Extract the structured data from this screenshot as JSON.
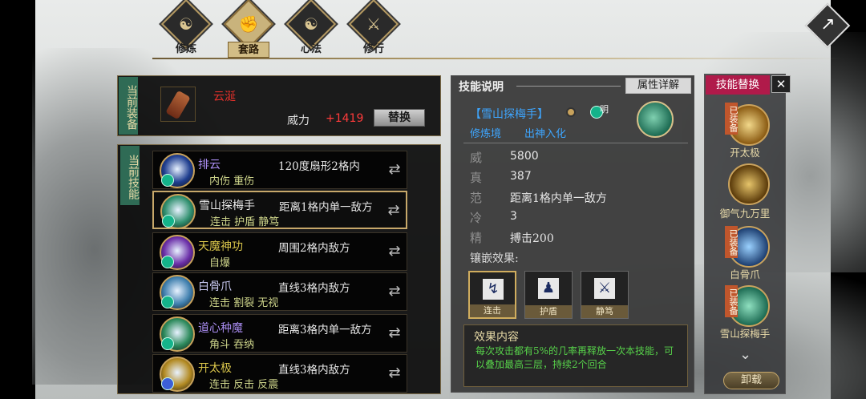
{
  "tabs": [
    {
      "label": "修炼",
      "icon": "cultivation-icon",
      "active": false
    },
    {
      "label": "套路",
      "icon": "fist-icon",
      "active": true
    },
    {
      "label": "心法",
      "icon": "taiji-icon",
      "active": false
    },
    {
      "label": "修行",
      "icon": "sword-icon",
      "active": false
    }
  ],
  "equip": {
    "section_label": "当前装备",
    "name": "云涎",
    "power_label": "威力",
    "power_value": "+1419",
    "replace_label": "替换"
  },
  "skills_label": "当前技能",
  "skills": [
    {
      "name": "排云",
      "name_color": "#a98cf0",
      "range": "120度扇形2格内",
      "tags": "内伤 重伤",
      "icon_color": "#1f3e8f",
      "badge": "teal"
    },
    {
      "name": "雪山探梅手",
      "name_color": "#e8e8e8",
      "range": "距离1格内单一敌方",
      "tags": "连击 护盾 静笃",
      "icon_color": "#2f8f6e",
      "badge": "teal",
      "selected": true
    },
    {
      "name": "天魔神功",
      "name_color": "#d8c44a",
      "range": "周围2格内敌方",
      "tags": "自爆",
      "icon_color": "#6b2fa8",
      "badge": "teal"
    },
    {
      "name": "白骨爪",
      "name_color": "#c8c8f0",
      "range": "直线3格内敌方",
      "tags": "连击 割裂 无视",
      "icon_color": "#3f7fae",
      "badge": "teal"
    },
    {
      "name": "道心种魔",
      "name_color": "#a98cf0",
      "range": "距离3格内单一敌方",
      "tags": "角斗 吞纳",
      "icon_color": "#2d8a5c",
      "badge": "teal"
    },
    {
      "name": "开太极",
      "name_color": "#d8c44a",
      "range": "直线3格内敌方",
      "tags": "连击 反击 反震",
      "icon_color": "#b38a22",
      "badge": "blue"
    }
  ],
  "detail": {
    "header": "技能说明",
    "attr_button": "属性详解",
    "skill_name": "【雪山探梅手】",
    "realm_label": "修炼境",
    "realm_value": "出神入化",
    "badge_text": "明",
    "stats": [
      {
        "k": "威",
        "v": "5800"
      },
      {
        "k": "真",
        "v": "387"
      },
      {
        "k": "范",
        "v": "距离1格内单一敌方"
      },
      {
        "k": "冷",
        "v": "3"
      },
      {
        "k": "精",
        "v": "搏击200"
      }
    ],
    "inlay_label": "镶嵌效果:",
    "gems": [
      {
        "label": "连击",
        "icon": "combo-icon",
        "selected": true
      },
      {
        "label": "护盾",
        "icon": "shield-icon",
        "selected": false
      },
      {
        "label": "静笃",
        "icon": "calm-icon",
        "selected": false
      }
    ],
    "effect_title": "效果内容",
    "effect_text": "每次攻击都有5%的几率再释放一次本技能，可以叠加最高三层，持续2个回合"
  },
  "replace_panel": {
    "title": "技能替换",
    "close": "✕",
    "items": [
      {
        "name": "开太极",
        "equipped": true,
        "tag": "已装备"
      },
      {
        "name": "御气九万里",
        "equipped": false,
        "tag": ""
      },
      {
        "name": "白骨爪",
        "equipped": true,
        "tag": "已装备"
      },
      {
        "name": "雪山探梅手",
        "equipped": true,
        "tag": "已装备"
      }
    ],
    "unload_label": "卸载"
  },
  "colors": {
    "accent_gold": "#c7a86a",
    "power_red": "#ff3b3b",
    "effect_green": "#57d24a",
    "name_blue": "#3ea6ff"
  }
}
